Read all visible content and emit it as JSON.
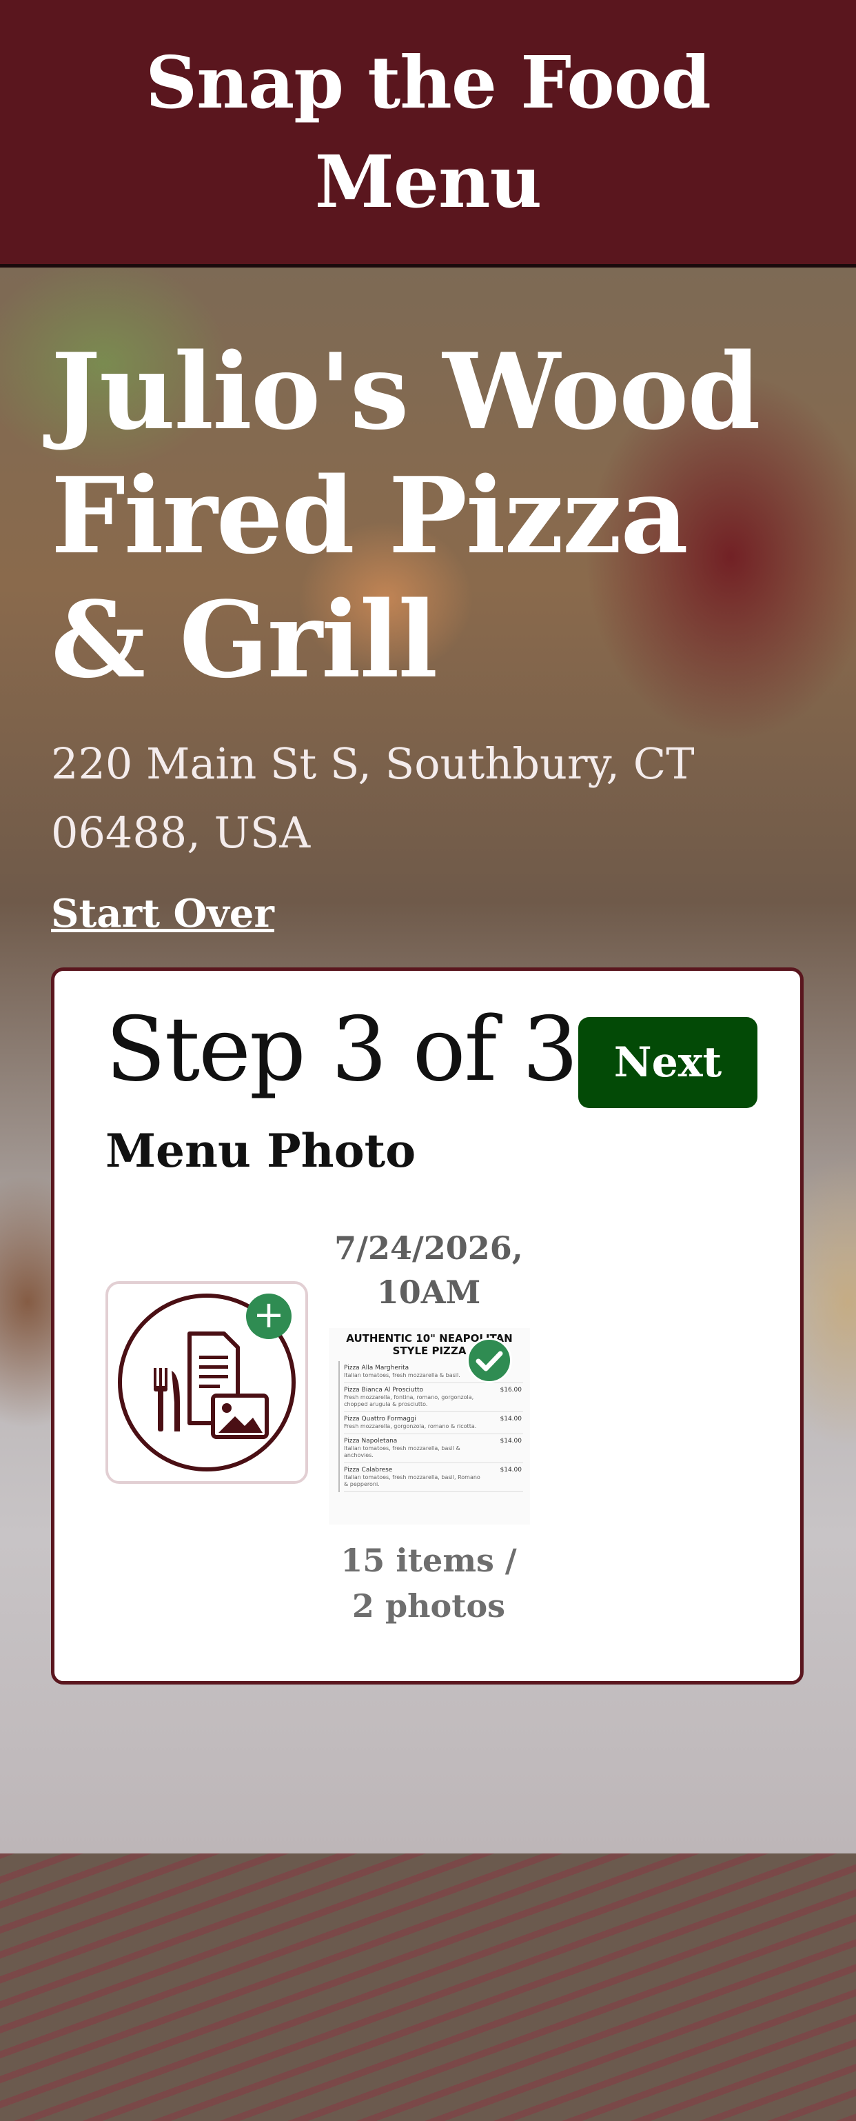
{
  "header": {
    "title": "Snap the Food Menu"
  },
  "restaurant": {
    "name": "Julio's Wood Fired Pizza & Grill",
    "address": "220 Main St S, Southbury, CT 06488, USA",
    "start_over_label": "Start Over"
  },
  "step": {
    "title": "Step 3 of 3",
    "next_label": "Next",
    "section_title": "Menu Photo"
  },
  "add_photo": {
    "plus_symbol": "+",
    "icon": "menu-photo-add-icon"
  },
  "photo": {
    "date": "7/24/2026, 10AM",
    "count_text": "15 items / 2 photos",
    "thumb": {
      "heading": "AUTHENTIC 10\" NEAPOLITAN STYLE PIZZA",
      "items": [
        {
          "name": "Pizza Alla Margherita",
          "price": "",
          "desc": "Italian tomatoes, fresh mozzarella & basil."
        },
        {
          "name": "Pizza Bianca Al Prosciutto",
          "price": "$16.00",
          "desc": "Fresh mozzarella, fontina, romano, gorgonzola, chopped arugula & prosciutto."
        },
        {
          "name": "Pizza Quattro Formaggi",
          "price": "$14.00",
          "desc": "Fresh mozzarella, gorgonzola, romano & ricotta."
        },
        {
          "name": "Pizza Napoletana",
          "price": "$14.00",
          "desc": "Italian tomatoes, fresh mozzarella, basil & anchovies."
        },
        {
          "name": "Pizza Calabrese",
          "price": "$14.00",
          "desc": "Italian tomatoes, fresh mozzarella, basil, Romano & pepperoni."
        }
      ]
    }
  },
  "colors": {
    "brand": "#5a161e",
    "next_button": "#034a06",
    "badge_green": "#2f8c52"
  }
}
